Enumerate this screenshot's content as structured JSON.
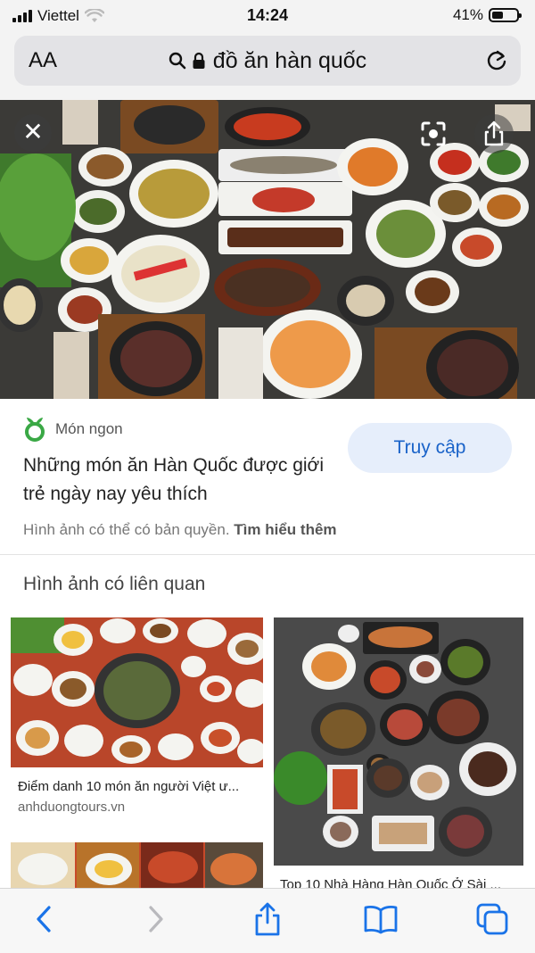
{
  "status_bar": {
    "carrier": "Viettel",
    "time": "14:24",
    "battery": "41%"
  },
  "address_bar": {
    "text_size_label": "AA",
    "query": "đồ ăn hàn quốc"
  },
  "result": {
    "source": "Món ngon",
    "title": "Những món ăn Hàn Quốc được giới trẻ ngày nay yêu thích",
    "visit_label": "Truy cập",
    "copyright_note": "Hình ảnh có thể có bản quyền.",
    "learn_more": "Tìm hiểu thêm"
  },
  "related": {
    "heading": "Hình ảnh có liên quan",
    "items": [
      {
        "caption": "Điểm danh 10 món ăn người Việt ư...",
        "domain": "anhduongtours.vn"
      },
      {
        "caption": "Top 10 Nhà Hàng Hàn Quốc Ở Sài ..."
      }
    ]
  },
  "colors": {
    "accent": "#1a63c9",
    "visit_bg": "#e6eefb",
    "logo_green": "#3aa845"
  }
}
